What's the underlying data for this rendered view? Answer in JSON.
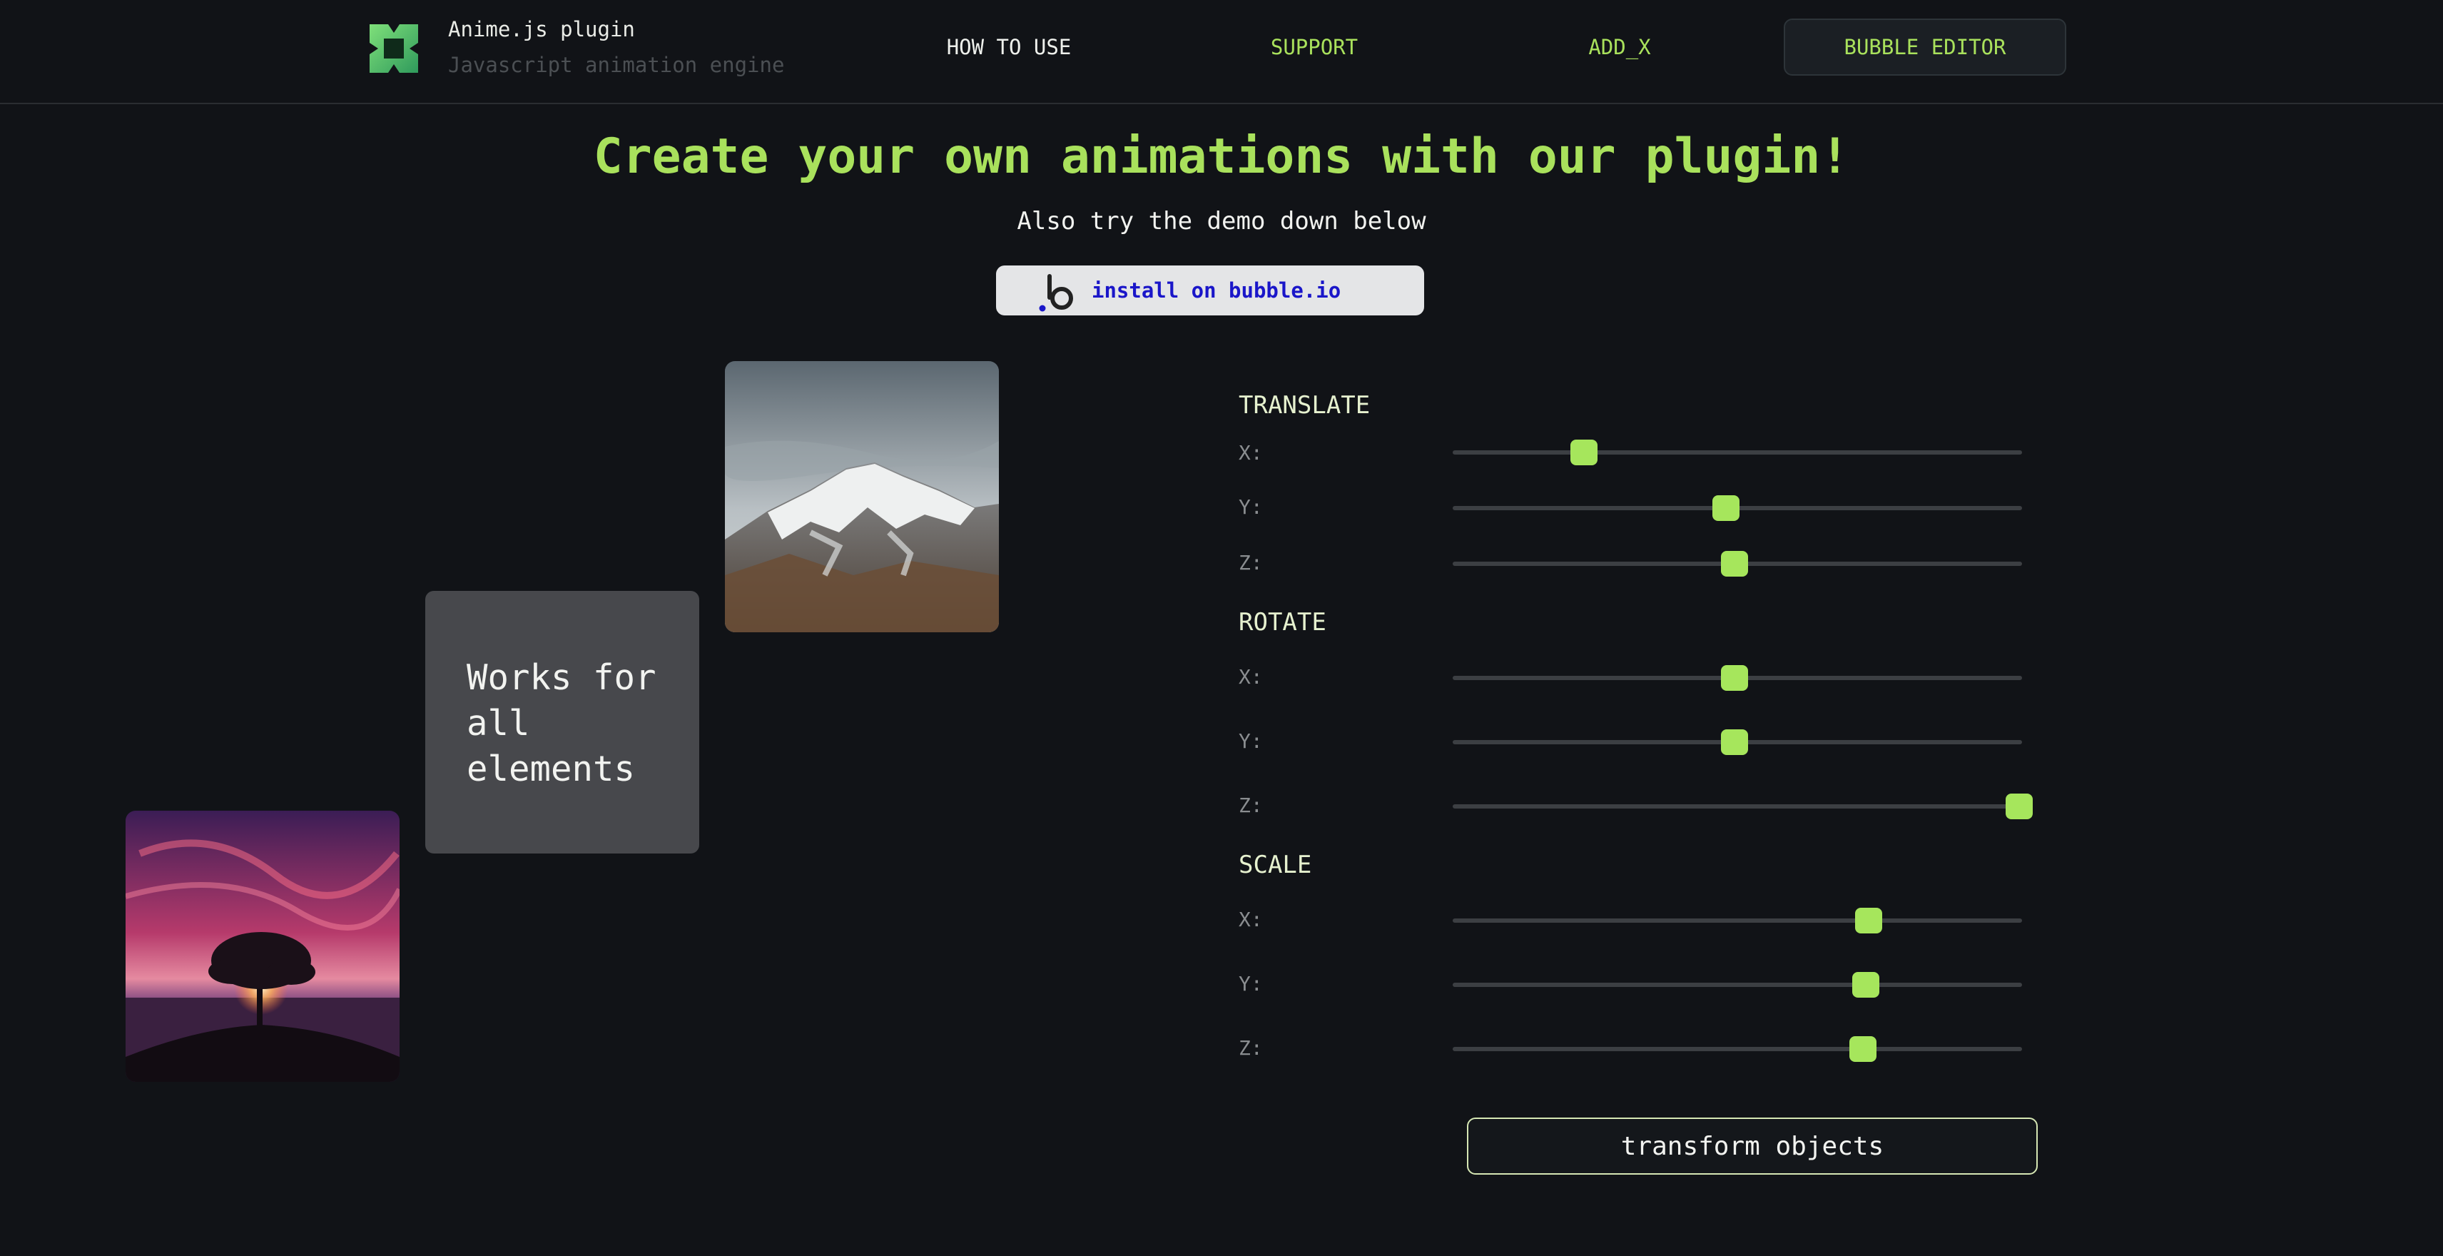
{
  "header": {
    "brand_title": "Anime.js plugin",
    "brand_subtitle": "Javascript animation engine",
    "nav": [
      "HOW TO USE",
      "SUPPORT",
      "ADD_X",
      "BUBBLE EDITOR"
    ]
  },
  "hero": {
    "title": "Create your own animations with our plugin!",
    "subtitle": "Also try the demo down below",
    "install_label": "install on bubble.io"
  },
  "demo": {
    "card_text": "Works for all elements"
  },
  "controls": {
    "translate": {
      "title": "TRANSLATE",
      "x_label": "X:",
      "y_label": "Y:",
      "z_label": "Z:",
      "x_value": 0.23,
      "y_value": 0.48,
      "z_value": 0.495
    },
    "rotate": {
      "title": "ROTATE",
      "x_label": "X:",
      "y_label": "Y:",
      "z_label": "Z:",
      "x_value": 0.495,
      "y_value": 0.495,
      "z_value": 0.995
    },
    "scale": {
      "title": "SCALE",
      "x_label": "X:",
      "y_label": "Y:",
      "z_label": "Z:",
      "x_value": 0.73,
      "y_value": 0.725,
      "z_value": 0.72
    },
    "transform_button": "transform objects"
  },
  "colors": {
    "background": "#111317",
    "accent": "#a9e15c",
    "card": "#47484c",
    "install_text": "#1a16c9"
  },
  "icons": {
    "brand_logo": "animejs-logo-icon",
    "install_logo": "bubble-logo-icon"
  }
}
